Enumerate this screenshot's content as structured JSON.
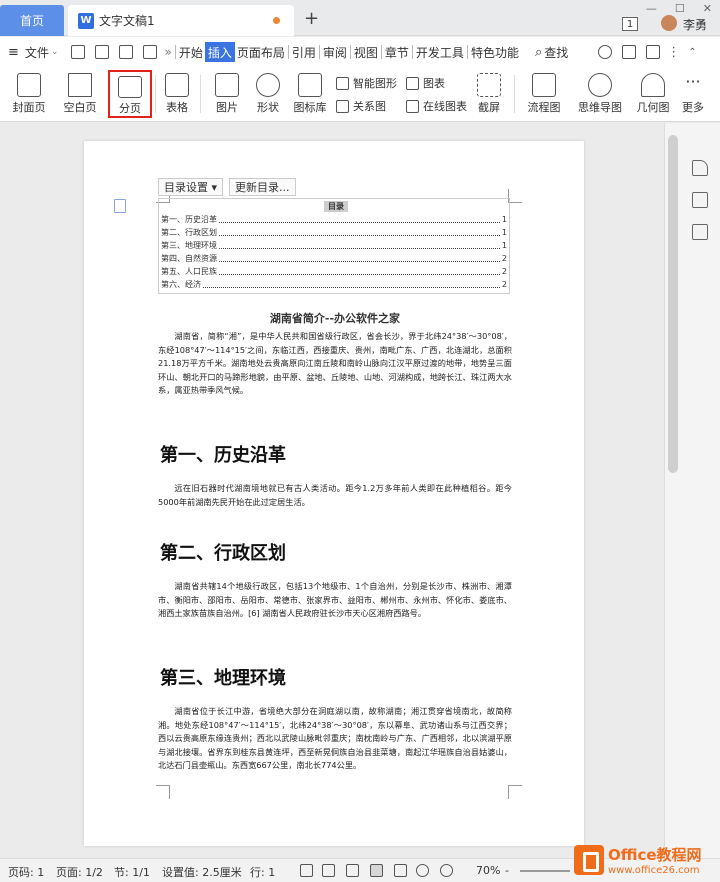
{
  "titlebar": {
    "home_tab": "首页",
    "doc_tab": "文字文稿1",
    "doc_tab_icon": "W",
    "new_tab": "+",
    "page_badge": "1",
    "username": "李勇"
  },
  "menu": {
    "file": "文件",
    "more": "»",
    "tabs": [
      "开始",
      "插入",
      "页面布局",
      "引用",
      "审阅",
      "视图",
      "章节",
      "开发工具",
      "特色功能"
    ],
    "active_tab": "插入",
    "search": "查找"
  },
  "ribbon": {
    "cover": "封面页",
    "blank": "空白页",
    "pagebreak": "分页",
    "table": "表格",
    "picture": "图片",
    "shape": "形状",
    "iconlib": "图标库",
    "smartart": "智能图形",
    "chart": "图表",
    "relation": "关系图",
    "online_chart": "在线图表",
    "screenshot": "截屏",
    "flowchart": "流程图",
    "mindmap": "思维导图",
    "geometry": "几何图",
    "more": "更多"
  },
  "toc": {
    "settings": "目录设置",
    "update": "更新目录...",
    "title": "目录",
    "entries": [
      {
        "label": "第一、历史沿革",
        "page": "1"
      },
      {
        "label": "第二、行政区划",
        "page": "1"
      },
      {
        "label": "第三、地理环境",
        "page": "1"
      },
      {
        "label": "第四、自然资源",
        "page": "2"
      },
      {
        "label": "第五、人口民族",
        "page": "2"
      },
      {
        "label": "第六、经济",
        "page": "2"
      }
    ]
  },
  "doc": {
    "title": "湖南省简介--办公软件之家",
    "intro": "湖南省，简称“湘”，是中华人民共和国省级行政区，省会长沙，界于北纬24°38′～30°08′，东经108°47′～114°15′之间，东临江西，西接重庆、贵州，南毗广东、广西，北连湖北，总面积21.18万平方千米。湖南地处云贵高原向江南丘陵和南岭山脉向江汉平原过渡的地带，地势呈三面环山、朝北开口的马蹄形地貌，由平原、盆地、丘陵地、山地、河湖构成，地跨长江、珠江两大水系，属亚热带季风气候。",
    "h1": "第一、历史沿革",
    "p1": "远在旧石器时代湖南境地就已有古人类活动。距今1.2万多年前人类即在此种植稻谷。距今5000年前湖南先民开始在此过定居生活。",
    "h2": "第二、行政区划",
    "p2": "湖南省共辖14个地级行政区，包括13个地级市、1个自治州，分别是长沙市、株洲市、湘潭市、衡阳市、邵阳市、岳阳市、常德市、张家界市、益阳市、郴州市、永州市、怀化市、娄底市、湘西土家族苗族自治州。[6] 湖南省人民政府驻长沙市天心区湘府西路号。",
    "h3": "第三、地理环境",
    "p3": "湖南省位于长江中游，省境绝大部分在洞庭湖以南，故称湖南；湘江贯穿省境南北，故简称湘。地处东经108°47′～114°15′，北纬24°38′～30°08′，东以幕阜、武功诸山系与江西交界；西以云贵高原东缘连贵州；西北以武陵山脉毗邻重庆；南枕南岭与广东、广西相邻，北以滨湖平原与湖北接壤。省界东到桂东县黄连坪，西至新晃侗族自治县韭菜塘，南起江华瑶族自治县姑婆山，北达石门县壶瓶山。东西宽667公里，南北长774公里。"
  },
  "status": {
    "page_no": "页码: 1",
    "pages": "页面: 1/2",
    "section": "节: 1/1",
    "setting": "设置值: 2.5厘米",
    "row": "行: 1",
    "zoom": "70%",
    "zoom_minus": "-"
  },
  "watermark": {
    "brand": "Office教程网",
    "url": "www.office26.com"
  },
  "colors": {
    "accent": "#3a74e0",
    "home_tab": "#5b8fe8",
    "highlight": "#e0211c",
    "watermark": "#ef6c1b"
  }
}
